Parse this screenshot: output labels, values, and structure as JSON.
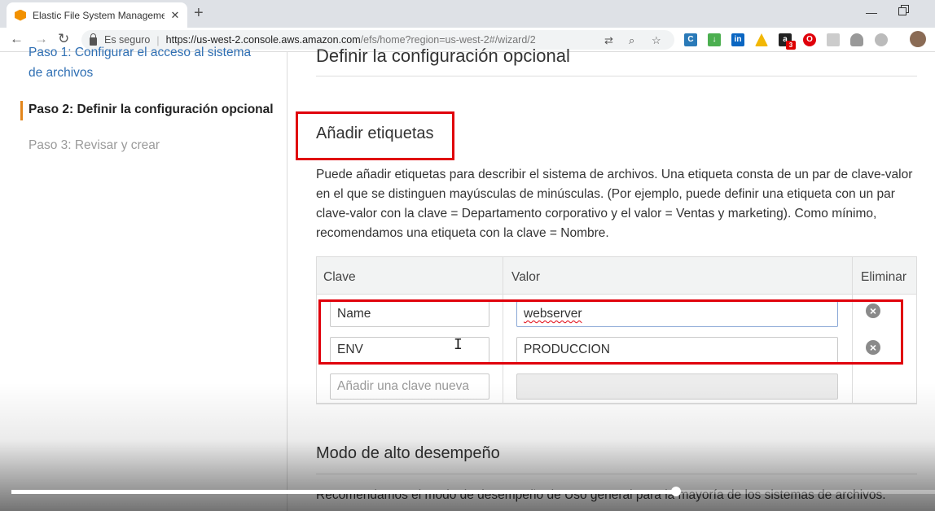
{
  "browser": {
    "tab_title": "Elastic File System Management /",
    "tab_close": "✕",
    "new_tab": "+",
    "secure_label": "Es seguro",
    "url_host": "https://us-west-2.console.aws.amazon.com",
    "url_path": "/efs/home?region=us-west-2#/wizard/2",
    "extension_badge": "3"
  },
  "sidebar": {
    "steps": [
      {
        "label": "Paso 1: Configurar el acceso al sistema",
        "state": "link"
      },
      {
        "label": "de archivos",
        "state": "link"
      },
      {
        "label": "Paso 2: Definir la configuración opcional",
        "state": "active"
      },
      {
        "label": "Paso 3: Revisar y crear",
        "state": "disabled"
      }
    ]
  },
  "main": {
    "section_title": "Definir la configuración opcional",
    "tags_title": "Añadir etiquetas",
    "tags_description": "Puede añadir etiquetas para describir el sistema de archivos. Una etiqueta consta de un par de clave-valor en el que se distinguen mayúsculas de minúsculas. (Por ejemplo, puede definir una etiqueta con un par clave-valor con la clave = Departamento corporativo y el valor = Ventas y marketing). Como mínimo, recomendamos una etiqueta con la clave = Nombre.",
    "table": {
      "headers": {
        "key": "Clave",
        "value": "Valor",
        "remove": "Eliminar"
      },
      "rows": [
        {
          "key": "Name",
          "value": "webserver"
        },
        {
          "key": "ENV",
          "value": "PRODUCCION"
        }
      ],
      "new_key_placeholder": "Añadir una clave nueva"
    },
    "perf_title": "Modo de alto desempeño",
    "perf_desc": "Recomendamos el modo de desempeño de Uso general para la mayoría de los sistemas de archivos."
  },
  "video": {
    "progress": 0.72
  },
  "colors": {
    "accent_orange": "#e3861b",
    "link_blue": "#2f6fb3",
    "highlight_red": "#e0000b"
  }
}
